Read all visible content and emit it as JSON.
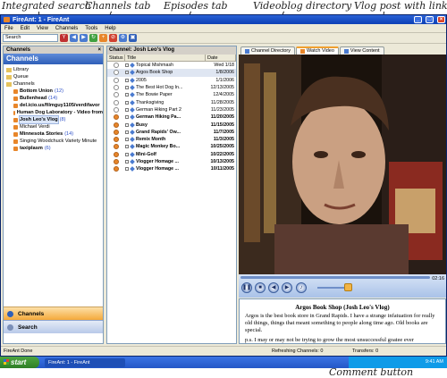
{
  "callouts": {
    "integrated_search": "Integrated search",
    "channels_tab": "Channels tab",
    "episodes_tab": "Episodes tab",
    "videoblog_directory": "Videoblog directory",
    "vlog_post": "Vlog post with links",
    "comment_button": "Comment button"
  },
  "window": {
    "title": "FireAnt: 1 - FireAnt"
  },
  "menu": [
    "File",
    "Edit",
    "View",
    "Channels",
    "Tools",
    "Help"
  ],
  "toolbar": {
    "search_value": "Search"
  },
  "channels_pane": {
    "header": "Channels",
    "close": "×",
    "title": "Channels",
    "tree": [
      {
        "label": "Library",
        "count": "",
        "bold": false,
        "indent": false,
        "icon": "folder-icon"
      },
      {
        "label": "Queue",
        "count": "",
        "bold": false,
        "indent": false,
        "icon": "folder-icon"
      },
      {
        "label": "Channels",
        "count": "",
        "bold": false,
        "indent": false,
        "icon": "folder-icon"
      },
      {
        "label": "Bottom Union",
        "count": "(12)",
        "bold": true,
        "indent": true,
        "icon": "channel-icon"
      },
      {
        "label": "Bullenhead",
        "count": "(14)",
        "bold": true,
        "indent": true,
        "icon": "channel-icon"
      },
      {
        "label": "del.icio.us/filmguy1105/verdifavor",
        "count": "",
        "bold": true,
        "indent": true,
        "icon": "channel-icon"
      },
      {
        "label": "Human Dog Laboratory - Video from",
        "count": "",
        "bold": true,
        "indent": true,
        "icon": "channel-icon"
      },
      {
        "label": "Josh Leo's Vlog",
        "count": "(8)",
        "bold": true,
        "indent": true,
        "icon": "channel-icon",
        "selected": true
      },
      {
        "label": "Michael Verdi",
        "count": "",
        "bold": false,
        "indent": true,
        "icon": "channel-icon"
      },
      {
        "label": "Minnesota Stories",
        "count": "(14)",
        "bold": true,
        "indent": true,
        "icon": "channel-icon"
      },
      {
        "label": "Singing Woodchuck Variety Minute",
        "count": "",
        "bold": false,
        "indent": true,
        "icon": "channel-icon"
      },
      {
        "label": "taxiplasm",
        "count": "(6)",
        "bold": true,
        "indent": true,
        "icon": "channel-icon"
      }
    ],
    "nav_channels": "Channels",
    "nav_search": "Search"
  },
  "episodes_pane": {
    "header": "Channel: Josh Leo's Vlog",
    "col_status": "Status",
    "col_title": "Title",
    "col_date": "Date",
    "rows": [
      {
        "title": "Topical Mishmash",
        "date": "Wed 1/18",
        "new": false
      },
      {
        "title": "Argos Book Shop",
        "date": "1/8/2006",
        "new": false,
        "selected": true
      },
      {
        "title": "2005",
        "date": "1/1/2006",
        "new": false
      },
      {
        "title": "The Best Hot Dog In...",
        "date": "12/13/2005",
        "new": false
      },
      {
        "title": "The Bowie Paper",
        "date": "12/4/2005",
        "new": false
      },
      {
        "title": "Thanksgiving",
        "date": "11/28/2005",
        "new": false
      },
      {
        "title": "German Hiking Part 2",
        "date": "11/23/2005",
        "new": false
      },
      {
        "title": "German Hiking Pa...",
        "date": "11/20/2005",
        "new": true
      },
      {
        "title": "Busy",
        "date": "11/15/2005",
        "new": true
      },
      {
        "title": "Grand Rapids' Ow...",
        "date": "11/7/2005",
        "new": true
      },
      {
        "title": "Remix Month",
        "date": "11/3/2005",
        "new": true
      },
      {
        "title": "Magic Monkey Bo...",
        "date": "10/25/2005",
        "new": true
      },
      {
        "title": "Mini-Golf",
        "date": "10/22/2005",
        "new": true
      },
      {
        "title": "Vlogger Homage ...",
        "date": "10/13/2005",
        "new": true
      },
      {
        "title": "Vlogger Homage ...",
        "date": "10/11/2005",
        "new": true
      }
    ]
  },
  "right_pane": {
    "tabs": [
      "Channel Directory",
      "Watch Video",
      "View Content"
    ],
    "active_tab": "Watch Video",
    "time": "02:16",
    "post_title": "Argos Book Shop (Josh Leo's Vlog)",
    "post_p1": "Argos is the best book store in Grand Rapids. I have a strange infatuation for really old things, things that meant something to people along time ago. Old books are special.",
    "post_p2": "p.s. I may or may not be trying to grow the most unsuccessful goatee ever"
  },
  "status": {
    "left": "FireAnt  Done",
    "refreshing": "Refreshing Channels: 0",
    "transfers": "Transfers: 0"
  },
  "taskbar": {
    "start": "start",
    "task": "FireAnt: 1 - FireAnt",
    "clock": "9:41 AM"
  },
  "colors": {
    "accent": "#e8862a",
    "title_blue": "#0b3fb5",
    "taskbar_blue": "#2457c7",
    "start_green": "#2e7e25"
  }
}
